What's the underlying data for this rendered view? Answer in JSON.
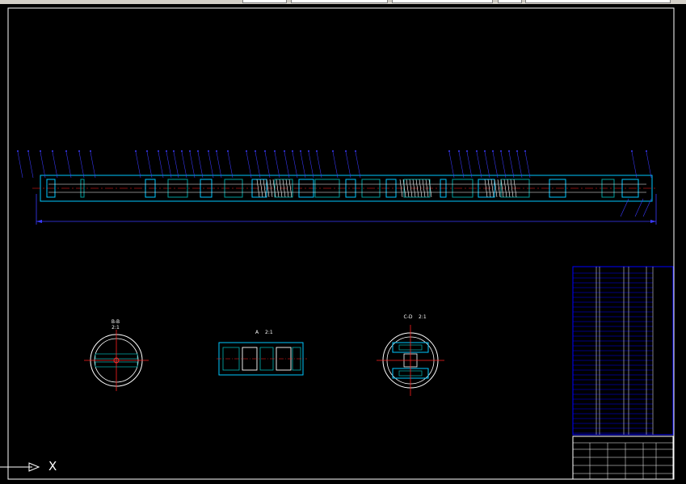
{
  "drawing": {
    "background": "#000000",
    "frame_color": "#ffffff",
    "part_color": "#00c8ff",
    "dim_color": "#3a3aff",
    "center_color": "#ff2020",
    "hatch_color": "#00a0a0"
  },
  "views": {
    "section_bb": {
      "title": "B-B",
      "scale": "2:1"
    },
    "detail_a": {
      "title": "A",
      "scale": "2:1"
    },
    "section_cd": {
      "title": "C-D",
      "scale": "2:1"
    }
  },
  "ucs": {
    "axis_label": "X"
  }
}
